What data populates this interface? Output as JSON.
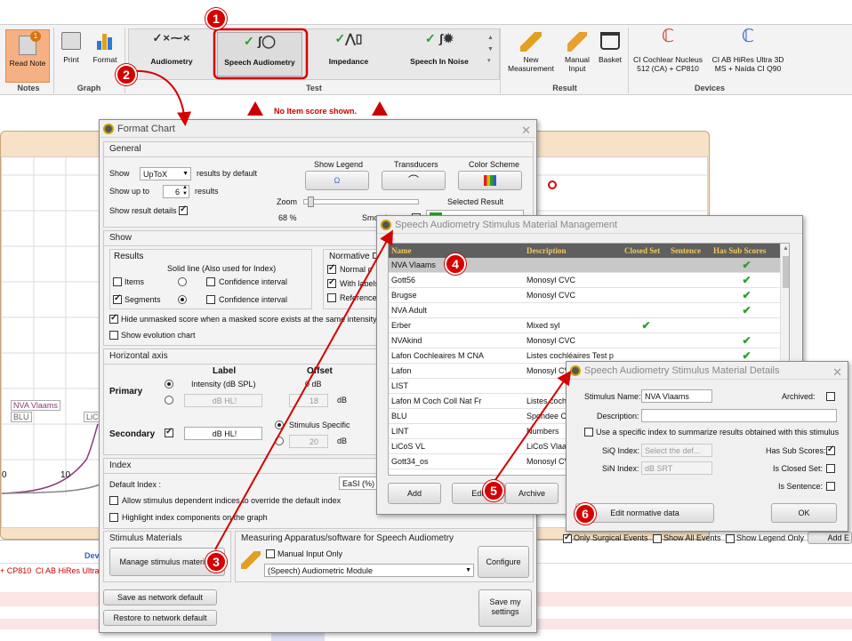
{
  "ribbon": {
    "read_note": "Read Note",
    "print": "Print",
    "format": "Format",
    "notes_group": "Notes",
    "graph_group": "Graph",
    "tests": [
      "Audiometry",
      "Speech Audiometry",
      "Impedance",
      "Speech In Noise"
    ],
    "test_group": "Test",
    "new_measurement": "New Measurement",
    "manual_input": "Manual Input",
    "basket": "Basket",
    "result_group": "Result",
    "device1": "CI Cochlear Nucleus 512 (CA) + CP810",
    "device2": "CI AB HiRes Ultra 3D MS + Naída CI Q90",
    "devices_group": "Devices"
  },
  "warning": "No Item score shown.",
  "chart": {
    "x_ticks": [
      "0",
      "10"
    ],
    "labels": [
      "NVA Vlaams",
      "BLU",
      "LiCo"
    ]
  },
  "bottom": {
    "dev": "Dev",
    "cp810": "+ CP810",
    "ab": "CI AB HiRes Ultra"
  },
  "filters": {
    "only_surgical": "Only Surgical Events",
    "show_all": "Show All Events",
    "show_legend": "Show Legend Only",
    "add": "Add E"
  },
  "callouts": [
    "1",
    "2",
    "3",
    "4",
    "5",
    "6"
  ],
  "format_chart": {
    "title": "Format Chart",
    "general": "General",
    "show": "Show",
    "show_value": "UpToX",
    "results_by_default": "results by default",
    "show_up_to": "Show up to",
    "up_to_value": "6",
    "results": "results",
    "show_result_details": "Show result details",
    "show_legend": "Show Legend",
    "transducers": "Transducers",
    "color_scheme": "Color Scheme",
    "zoom": "Zoom",
    "zoom_value": "68 %",
    "smooth": "Smooth",
    "selected_result": "Selected Result",
    "show_section": "Show",
    "results_group": "Results",
    "solid_line": "Solid line (Also used for Index)",
    "items": "Items",
    "segments": "Segments",
    "confidence_interval": "Confidence interval",
    "normative": "Normative D",
    "normal": "Normal c",
    "with_labels": "With labels",
    "reference": "Reference",
    "hide_unmasked": "Hide unmasked score when a masked score exists at the same intensity",
    "show_evolution": "Show evolution chart",
    "horizontal_axis": "Horizontal axis",
    "label": "Label",
    "offset": "Offset",
    "primary": "Primary",
    "intensity": "Intensity (dB SPL)",
    "db_hl": "dB HL!",
    "zero_db": "0 dB",
    "eighteen": "18",
    "db": "dB",
    "secondary": "Secondary",
    "sec_value": "dB HL!",
    "stimulus_specific": "Stimulus Specific",
    "twenty": "20",
    "index": "Index",
    "default_index": "Default Index :",
    "easi": "EaSI (%)",
    "allow_dependent": "Allow stimulus dependent indices to override the default index",
    "highlight": "Highlight index components on the graph",
    "stimulus_materials": "Stimulus Materials",
    "manage": "Manage stimulus materials",
    "measuring": "Measuring Apparatus/software for Speech Audiometry",
    "manual_only": "Manual Input Only",
    "module": "(Speech) Audiometric Module",
    "configure": "Configure",
    "save_network": "Save as network default",
    "restore_network": "Restore to network default",
    "save_my": "Save my settings"
  },
  "material_mgmt": {
    "title": "Speech Audiometry Stimulus Material Management",
    "headers": [
      "Name",
      "Description",
      "Closed Set",
      "Sentence",
      "Has Sub Scores"
    ],
    "rows": [
      {
        "name": "NVA Vlaams",
        "desc": "",
        "closed": false,
        "sub": true
      },
      {
        "name": "Gott56",
        "desc": "Monosyl CVC",
        "closed": false,
        "sub": true
      },
      {
        "name": "Brugse",
        "desc": "Monosyl CVC",
        "closed": false,
        "sub": true
      },
      {
        "name": "NVA Adult",
        "desc": "",
        "closed": false,
        "sub": true
      },
      {
        "name": "Erber",
        "desc": "Mixed syl",
        "closed": true,
        "sub": false
      },
      {
        "name": "NVAkind",
        "desc": "Monosyl CVC",
        "closed": false,
        "sub": true
      },
      {
        "name": "Lafon Cochleaires M CNA",
        "desc": "Listes cochléaires Test p",
        "closed": false,
        "sub": true
      },
      {
        "name": "Lafon",
        "desc": "Monosyl CV",
        "closed": false,
        "sub": false
      },
      {
        "name": "LIST",
        "desc": "",
        "closed": false,
        "sub": false
      },
      {
        "name": "Lafon M Coch Coll Nat Fr",
        "desc": "Listes coch",
        "closed": false,
        "sub": false
      },
      {
        "name": "BLU",
        "desc": "Spondee C",
        "closed": false,
        "sub": false
      },
      {
        "name": "LINT",
        "desc": "Numbers",
        "closed": false,
        "sub": false
      },
      {
        "name": "LiCoS VL",
        "desc": "LiCoS Vlaam",
        "closed": false,
        "sub": false
      },
      {
        "name": "Gott34_os",
        "desc": "Monosyl CV",
        "closed": false,
        "sub": false
      }
    ],
    "add": "Add",
    "edit": "Edit",
    "archive": "Archive"
  },
  "details": {
    "title": "Speech Audiometry Stimulus Material Details",
    "stimulus_name": "Stimulus Name:",
    "name_value": "NVA Vlaams",
    "archived": "Archived:",
    "description": "Description:",
    "use_specific": "Use a specific index to summarize results obtained with this stimulus",
    "siq": "SiQ Index:",
    "siq_value": "Select the def...",
    "sin": "SiN Index:",
    "sin_value": "dB SRT",
    "has_sub": "Has Sub Scores:",
    "closed_set": "Is Closed Set:",
    "is_sentence": "Is Sentence:",
    "edit_normative": "Edit normative data",
    "ok": "OK"
  }
}
